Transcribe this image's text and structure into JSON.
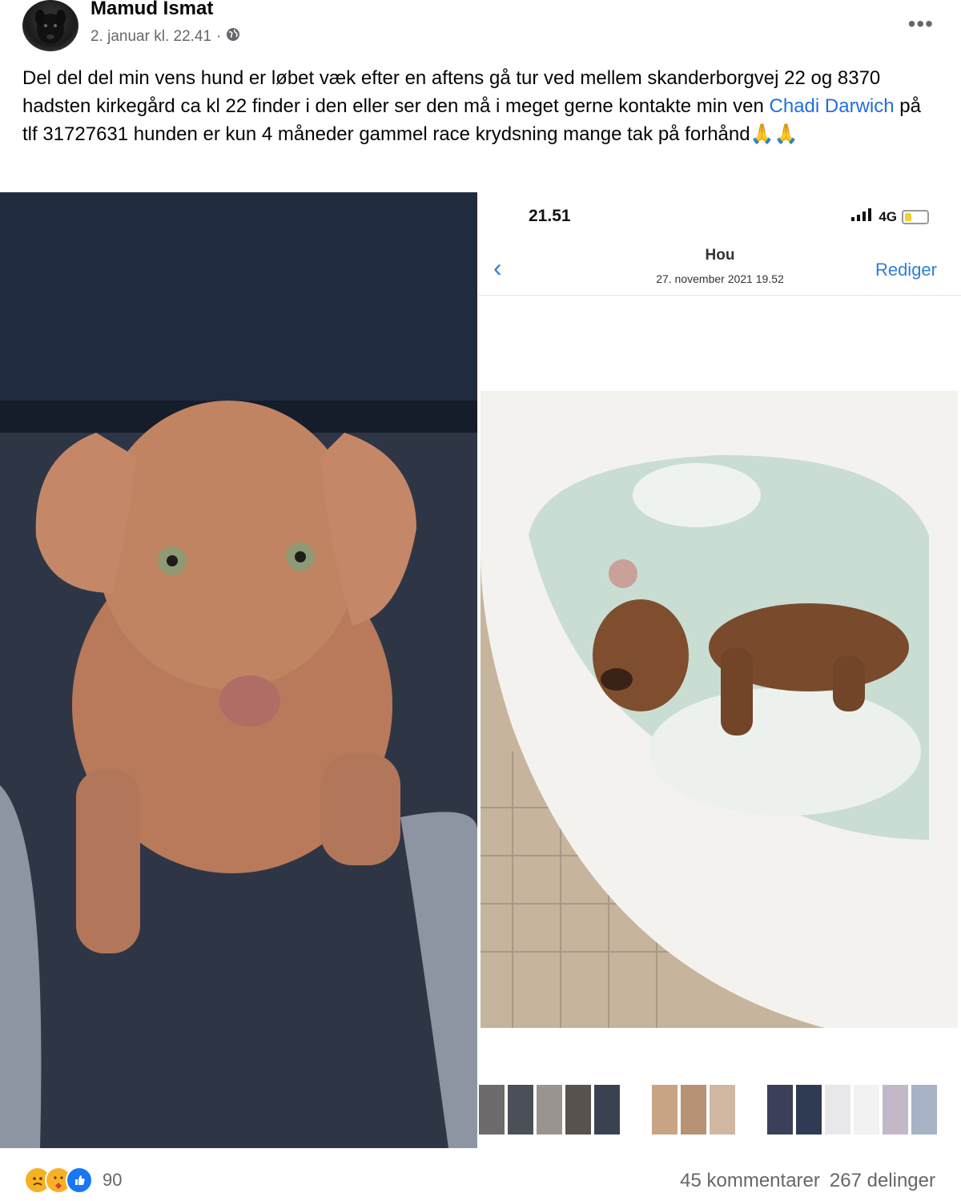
{
  "post": {
    "author": "Mamud Ismat",
    "timestamp": "2. januar kl. 22.41",
    "separator": "·",
    "privacy_icon": "globe-icon",
    "more_label": "•••",
    "text_part1": "Del del del min vens hund er løbet væk efter en aftens gå tur ved mellem skanderborgvej 22 og 8370  hadsten kirkegård ca kl 22 finder i den eller ser den må i meget gerne kontakte min ven ",
    "mention": "Chadi Darwich",
    "text_part2": " på tlf 31727631 hunden er kun 4 måneder gammel race krydsning mange tak på forhånd",
    "emoji": "🙏🙏"
  },
  "phone_screenshot": {
    "time": "21.51",
    "network": "4G",
    "nav_title": "Hou",
    "nav_subtitle": "27. november 2021  19.52",
    "back_label": "‹",
    "edit_label": "Rediger"
  },
  "footer": {
    "reactions": [
      "sad-icon",
      "care-icon",
      "like-icon"
    ],
    "reaction_count": "90",
    "comments": "45 kommentarer",
    "shares": "267 delinger"
  },
  "colors": {
    "link": "#216fdb",
    "ios_blue": "#2f7fd8",
    "secondary_text": "#65676b",
    "like_blue": "#1877f2"
  }
}
